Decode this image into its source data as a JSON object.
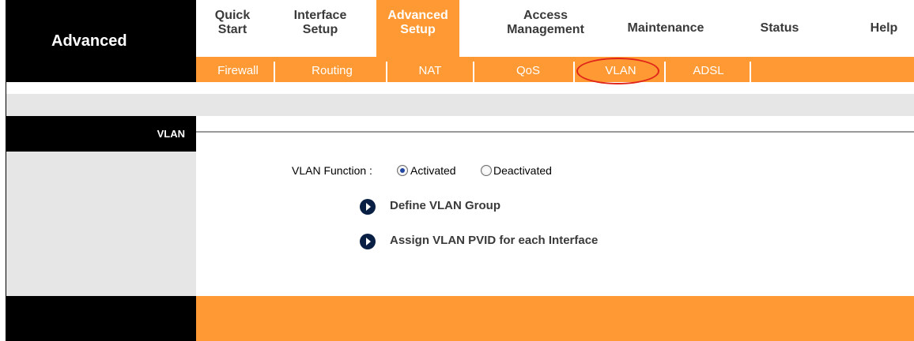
{
  "brand": {
    "title": "Advanced"
  },
  "top_nav": [
    {
      "id": "quick-start",
      "label": "Quick\nStart",
      "active": false
    },
    {
      "id": "interface-setup",
      "label": "Interface\nSetup",
      "active": false
    },
    {
      "id": "advanced-setup",
      "label": "Advanced\nSetup",
      "active": true
    },
    {
      "id": "access-management",
      "label": "Access\nManagement",
      "active": false
    },
    {
      "id": "maintenance",
      "label": "Maintenance",
      "active": false
    },
    {
      "id": "status",
      "label": "Status",
      "active": false
    },
    {
      "id": "help",
      "label": "Help",
      "active": false
    }
  ],
  "sub_nav": [
    {
      "id": "firewall",
      "label": "Firewall"
    },
    {
      "id": "routing",
      "label": "Routing"
    },
    {
      "id": "nat",
      "label": "NAT"
    },
    {
      "id": "qos",
      "label": "QoS"
    },
    {
      "id": "vlan",
      "label": "VLAN"
    },
    {
      "id": "adsl",
      "label": "ADSL"
    }
  ],
  "section": {
    "title": "VLAN"
  },
  "vlan_function": {
    "label": "VLAN Function :",
    "options": [
      "Activated",
      "Deactivated"
    ],
    "selected": "Activated"
  },
  "links": {
    "define_group": "Define VLAN Group",
    "assign_pvid": "Assign VLAN PVID for each Interface"
  },
  "colors": {
    "accent": "#ff9933",
    "highlight": "#e0261a",
    "sidebar": "#000000",
    "panel": "#e6e6e6"
  },
  "icons": {
    "link_icon": "arrow-right-circle-icon",
    "radio_icon": "radio-icon"
  }
}
